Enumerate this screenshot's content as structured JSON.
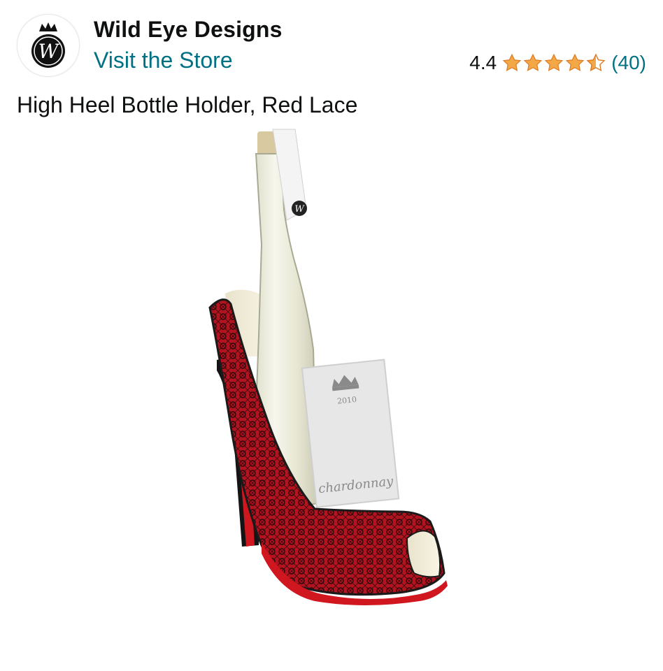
{
  "brand": {
    "name": "Wild Eye Designs",
    "logo_letter": "W",
    "visit_store_label": "Visit the Store"
  },
  "rating": {
    "value": "4.4",
    "stars": 4.4,
    "star_color": "#f3a847",
    "count": "(40)"
  },
  "product": {
    "title": "High Heel Bottle Holder, Red Lace",
    "image": {
      "neck_logo": "W",
      "label_year": "2010",
      "label_text": "chardonnay",
      "lace_color": "#b3121f",
      "sole_color": "#d0161f"
    }
  },
  "colors": {
    "link": "#007185",
    "text": "#0f1111"
  }
}
